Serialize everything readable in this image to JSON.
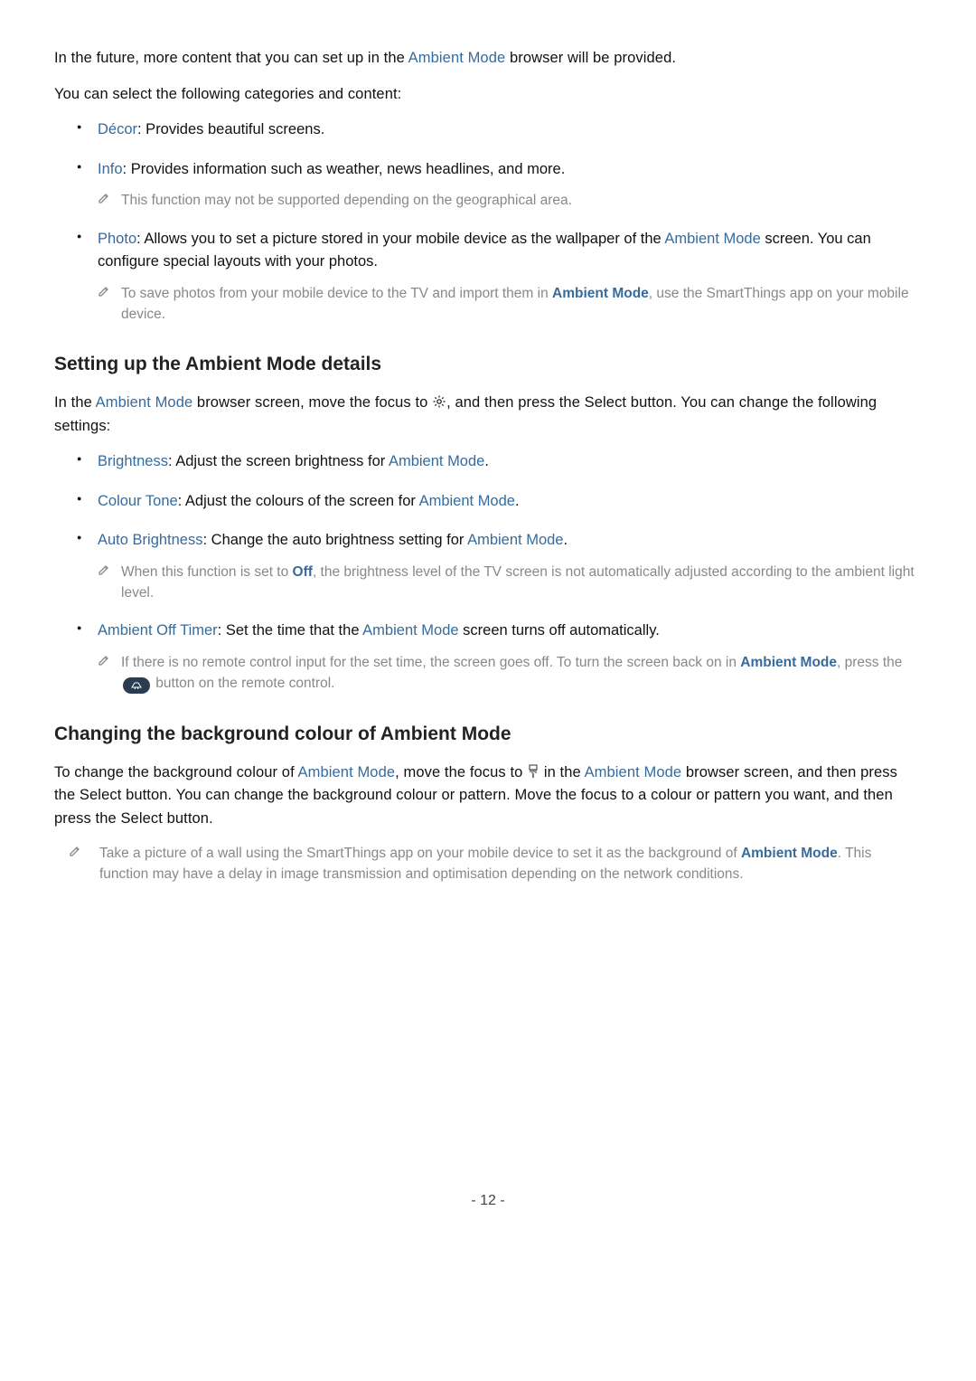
{
  "intro1_a": "In the future, more content that you can set up in the ",
  "link_ambient": "Ambient Mode",
  "intro1_b": " browser will be provided.",
  "intro2": "You can select the following categories and content:",
  "li_decor_l": "Décor",
  "li_decor_t": ": Provides beautiful screens.",
  "li_info_l": "Info",
  "li_info_t": ": Provides information such as weather, news headlines, and more.",
  "li_info_note": "This function may not be supported depending on the geographical area.",
  "li_photo_l": "Photo",
  "li_photo_t1": ": Allows you to set a picture stored in your mobile device as the wallpaper of the ",
  "li_photo_t2": " screen. You can configure special layouts with your photos.",
  "li_photo_note_a": "To save photos from your mobile device to the TV and import them in ",
  "li_photo_note_b": ", use the SmartThings app on your mobile device.",
  "h2_settings": "Setting up the Ambient Mode details",
  "settings_p_a": "In the ",
  "settings_p_b": " browser screen, move the focus to ",
  "settings_p_c": ", and then press the Select button. You can change the following settings:",
  "li_bright_l": "Brightness",
  "li_bright_t1": ": Adjust the screen brightness for ",
  "li_bright_t2": ".",
  "li_colour_l": "Colour Tone",
  "li_colour_t1": ": Adjust the colours of the screen for ",
  "li_colour_t2": ".",
  "li_auto_l": "Auto Brightness",
  "li_auto_t1": ": Change the auto brightness setting for ",
  "li_auto_t2": ".",
  "li_auto_note_a": "When this function is set to ",
  "off_lbl": "Off",
  "li_auto_note_b": ", the brightness level of the TV screen is not automatically adjusted according to the ambient light level.",
  "li_timer_l": "Ambient Off Timer",
  "li_timer_t1": ": Set the time that the ",
  "li_timer_t2": " screen turns off automatically.",
  "li_timer_note_a": "If there is no remote control input for the set time, the screen goes off. To turn the screen back on in ",
  "li_timer_note_b": ", press the ",
  "li_timer_note_c": " button on the remote control.",
  "h2_bg": "Changing the background colour of Ambient Mode",
  "bg_p_a": "To change the background colour of ",
  "bg_p_b": ", move the focus to ",
  "bg_p_c": " in the ",
  "bg_p_d": " browser screen, and then press the Select button. You can change the background colour or pattern. Move the focus to a colour or pattern you want, and then press the Select button.",
  "bg_note_a": "Take a picture of a wall using the SmartThings app on your mobile device to set it as the background of ",
  "bg_note_b": ". This function may have a delay in image transmission and optimisation depending on the network conditions.",
  "page_num": "- 12 -"
}
